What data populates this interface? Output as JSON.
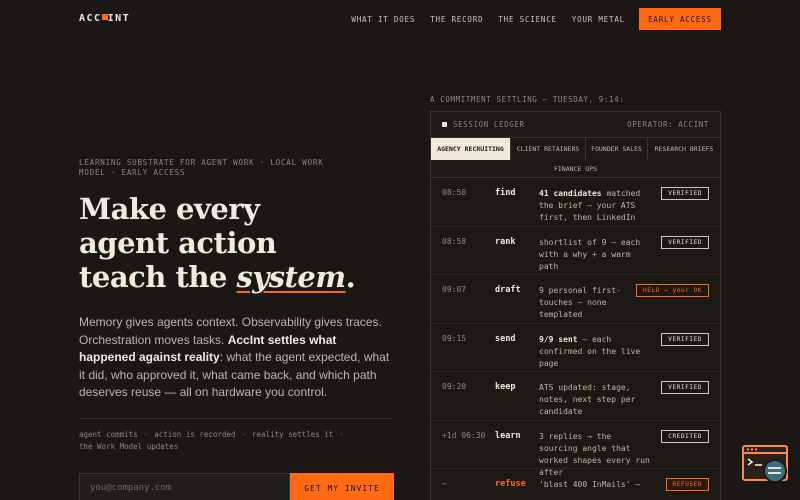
{
  "brand": {
    "logo_left": "ACC",
    "logo_right": "INT",
    "accent": "#ff6a13",
    "background": "#1a1714"
  },
  "nav": {
    "links": [
      "WHAT IT DOES",
      "THE RECORD",
      "THE SCIENCE",
      "YOUR METAL"
    ],
    "cta": "EARLY ACCESS"
  },
  "hero": {
    "eyebrow": "LEARNING SUBSTRATE FOR AGENT WORK · LOCAL WORK MODEL · EARLY ACCESS",
    "headline_line1": "Make every",
    "headline_line2": "agent action",
    "headline_line3_prefix": "teach the ",
    "headline_emphasis": "system",
    "headline_suffix": ".",
    "body_part1": "Memory gives agents context. Observability gives traces. Orchestration moves tasks. ",
    "body_bold": "AccInt settles what happened against reality",
    "body_part2": ": what the agent expected, what it did, who approved it, what came back, and which path deserves reuse — all on hardware you control.",
    "flow": [
      "agent commits",
      "action is recorded",
      "reality settles it",
      "the Work Model updates"
    ],
    "email_placeholder": "you@company.com",
    "invite_button": "GET MY INVITE"
  },
  "ledger": {
    "caption": "A COMMITMENT SETTLING — TUESDAY, 9:14:",
    "title": "SESSION LEDGER",
    "operator": "OPERATOR: ACCINT",
    "tabs": [
      "AGENCY RECRUITING",
      "CLIENT RETAINERS",
      "FOUNDER SALES",
      "RESEARCH BRIEFS",
      "FINANCE OPS"
    ],
    "rows": [
      {
        "time": "08:50",
        "verb": "find",
        "bold": "41 candidates",
        "desc": " matched the brief — your ATS first, then LinkedIn",
        "badge": "VERIFIED"
      },
      {
        "time": "08:58",
        "verb": "rank",
        "bold": "",
        "desc": "shortlist of 9 — each with a why + a warm path",
        "badge": "VERIFIED"
      },
      {
        "time": "09:07",
        "verb": "draft",
        "bold": "",
        "desc": "9 personal first-touches — none templated",
        "badge": "HELD → your OK"
      },
      {
        "time": "09:15",
        "verb": "send",
        "bold": "9/9 sent",
        "desc": " — each confirmed on the live page",
        "badge": "VERIFIED"
      },
      {
        "time": "09:20",
        "verb": "keep",
        "bold": "",
        "desc": "ATS updated: stage, notes, next step per candidate",
        "badge": "VERIFIED"
      },
      {
        "time": "+1d 06:30",
        "verb": "learn",
        "bold": "",
        "desc": "3 replies → the sourcing angle that worked shapes every run after",
        "badge": "CREDITED"
      },
      {
        "time": "—",
        "verb": "refuse",
        "bold": "",
        "desc": "'blast 400 InMails' —",
        "badge": "REFUSED"
      }
    ]
  },
  "support": {
    "icon": "support-chat-icon"
  }
}
